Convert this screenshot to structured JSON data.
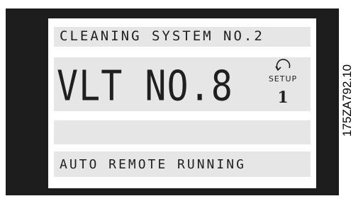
{
  "display": {
    "line1": "CLEANING SYSTEM NO.2",
    "main_id": "VLT NO.8",
    "setup": {
      "label": "SETUP",
      "value": "1",
      "icon": "curved-arrow-icon"
    },
    "line3": "",
    "line4": "AUTO REMOTE RUNNING"
  },
  "document_code": "175ZA792.10"
}
